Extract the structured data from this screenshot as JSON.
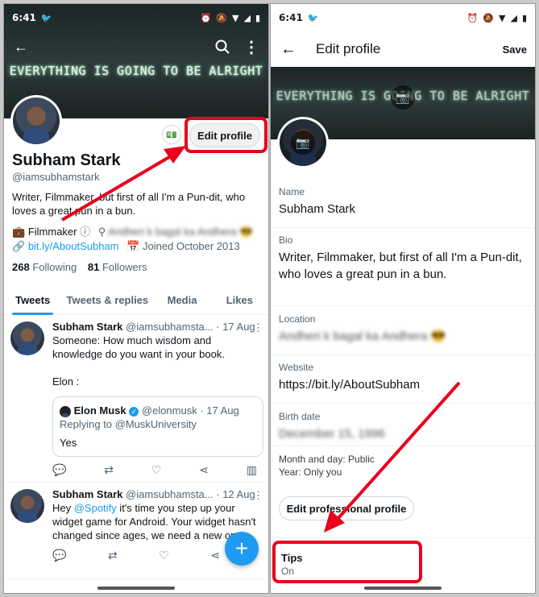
{
  "colors": {
    "accent": "#1d9bf0",
    "highlight": "#e8001c",
    "text": "#0f1419",
    "muted": "#536471"
  },
  "status_bar": {
    "time": "6:41"
  },
  "left": {
    "banner_text": "EVERYTHING IS GOING TO BE ALRIGHT",
    "edit_profile_label": "Edit profile",
    "display_name": "Subham Stark",
    "handle": "@iamsubhamstark",
    "bio": "Writer, Filmmaker, but first of all I'm a Pun-dit, who loves a great pun in a bun.",
    "profession": "Filmmaker",
    "location": "Andheri k bagal ka Andhera 😎",
    "website": "bit.ly/AboutSubham",
    "joined": "Joined October 2013",
    "following_count": "268",
    "following_label": "Following",
    "followers_count": "81",
    "followers_label": "Followers",
    "tabs": [
      "Tweets",
      "Tweets & replies",
      "Media",
      "Likes"
    ],
    "tweets": [
      {
        "author": "Subham Stark",
        "handle": "@iamsubhamsta...",
        "date": "· 17 Aug",
        "text": "Someone: How much wisdom and knowledge do you want in your book.",
        "text2": "Elon :",
        "quote": {
          "author": "Elon Musk",
          "handle": "@elonmusk",
          "date": "· 17 Aug",
          "reply_to": "Replying to @MuskUniversity",
          "text": "Yes"
        }
      },
      {
        "author": "Subham Stark",
        "handle": "@iamsubhamsta...",
        "date": "· 12 Aug",
        "text_pre": "Hey ",
        "mention": "@Spotify",
        "text_post": " it's time you step up your widget game for Android. Your widget hasn't changed since ages, we need a new one."
      }
    ],
    "fab_label": "+"
  },
  "right": {
    "header_title": "Edit profile",
    "save_label": "Save",
    "banner_text": "EVERYTHING IS GOING TO BE ALRIGHT",
    "fields": {
      "name_label": "Name",
      "name_value": "Subham Stark",
      "bio_label": "Bio",
      "bio_value": "Writer, Filmmaker, but first of all I'm a Pun-dit, who loves a great pun in a bun.",
      "location_label": "Location",
      "location_value": "Andheri k bagal ka Andhera 😎",
      "website_label": "Website",
      "website_value": "https://bit.ly/AboutSubham",
      "birth_label": "Birth date",
      "birth_value": "December 15, 1996",
      "visibility_line1": "Month and day: Public",
      "visibility_line2": "Year: Only you"
    },
    "edit_professional_label": "Edit professional profile",
    "tips_label": "Tips",
    "tips_value": "On"
  }
}
